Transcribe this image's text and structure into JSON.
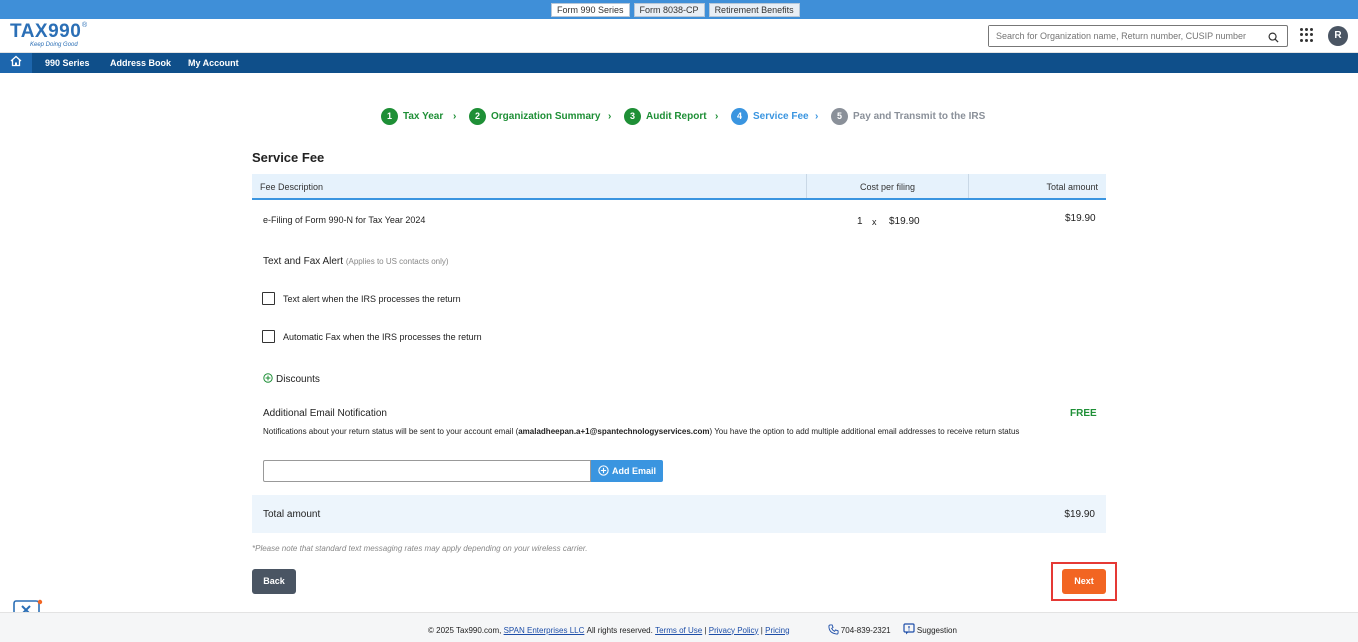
{
  "top_tabs": [
    "Form 990 Series",
    "Form 8038-CP",
    "Retirement Benefits"
  ],
  "logo": {
    "word": "TAX990",
    "reg": "®",
    "tagline": "Keep Doing Good"
  },
  "search": {
    "placeholder": "Search for Organization name, Return number, CUSIP number"
  },
  "avatar": {
    "initial": "R"
  },
  "nav": {
    "items": [
      "990 Series",
      "Address Book",
      "My Account"
    ]
  },
  "stepper": {
    "steps": [
      {
        "num": "1",
        "label": "Tax Year",
        "state": "done"
      },
      {
        "num": "2",
        "label": "Organization Summary",
        "state": "done"
      },
      {
        "num": "3",
        "label": "Audit Report",
        "state": "done"
      },
      {
        "num": "4",
        "label": "Service Fee",
        "state": "current"
      },
      {
        "num": "5",
        "label": "Pay and Transmit to the IRS",
        "state": "todo"
      }
    ]
  },
  "page": {
    "title": "Service Fee"
  },
  "table": {
    "headers": [
      "Fee Description",
      "Cost per filing",
      "Total amount"
    ],
    "row": {
      "description": "e-Filing of Form 990-N for Tax Year 2024",
      "qty": "1",
      "times": "x",
      "cost": "$19.90",
      "total": "$19.90"
    }
  },
  "alerts": {
    "title": "Text and Fax Alert",
    "note": "(Applies to US contacts only)",
    "text_alert": "Text alert when the IRS processes the return",
    "fax_alert": "Automatic Fax when the IRS processes the return"
  },
  "discounts": {
    "label": "Discounts"
  },
  "email_notification": {
    "title": "Additional Email Notification",
    "price": "FREE",
    "desc_start": "Notifications about your return status will be sent to your account email (",
    "email": "amaladheepan.a+1@spantechnologyservices.com",
    "desc_end": ") You have the option to add multiple additional email addresses to receive return status",
    "input_value": "",
    "add_button": "Add Email"
  },
  "total": {
    "label": "Total amount",
    "value": "$19.90"
  },
  "note": "*Please note that standard text messaging rates may apply depending on your wireless carrier.",
  "buttons": {
    "back": "Back",
    "next": "Next"
  },
  "footer": {
    "copyright": "© 2025 Tax990.com,",
    "company": "SPAN Enterprises LLC",
    "rights": "All rights reserved.",
    "terms": "Terms of Use",
    "privacy": "Privacy Policy",
    "pricing": "Pricing",
    "separator": "|",
    "phone": "704-839-2321",
    "suggestion": "Suggestion"
  },
  "colors": {
    "brand": "#2b6fb6",
    "nav": "#0f4f8a",
    "success": "#1e8f36",
    "accent": "#3a95e0",
    "next": "#f26522",
    "highlight": "#e53935"
  },
  "icons": [
    "home-icon",
    "search-icon",
    "apps-grid-icon",
    "chevron-right-icon",
    "plus-circle-icon",
    "phone-icon",
    "suggestion-icon",
    "chat-icon"
  ]
}
